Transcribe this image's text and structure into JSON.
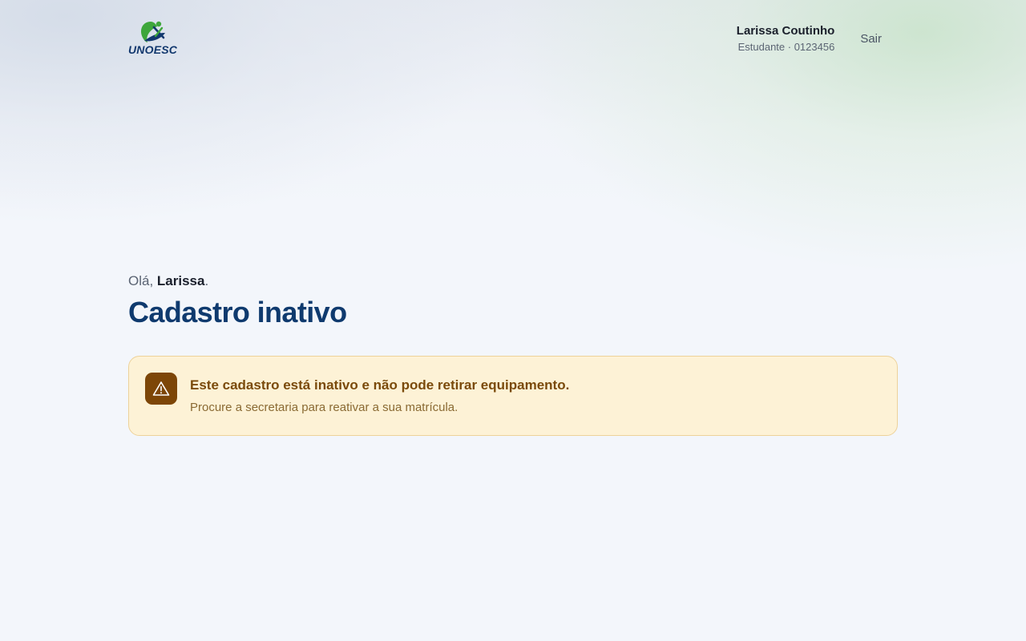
{
  "brand": {
    "name": "UNOESC",
    "colors": {
      "navy": "#12386e",
      "green": "#3ea63b"
    }
  },
  "header": {
    "user_name": "Larissa Coutinho",
    "user_meta": "Estudante · 0123456",
    "logout_label": "Sair"
  },
  "main": {
    "greeting_prefix": "Olá, ",
    "greeting_name": "Larissa",
    "greeting_suffix": ".",
    "title": "Cadastro inativo"
  },
  "alert": {
    "icon": "warning-triangle-icon",
    "title": "Este cadastro está inativo e não pode retirar equipamento.",
    "message": "Procure a secretaria para reativar a sua matrícula.",
    "colors": {
      "background": "#fdf2d6",
      "border": "#edd29a",
      "icon_bg": "#7d4607",
      "title": "#7a4a0a"
    }
  }
}
